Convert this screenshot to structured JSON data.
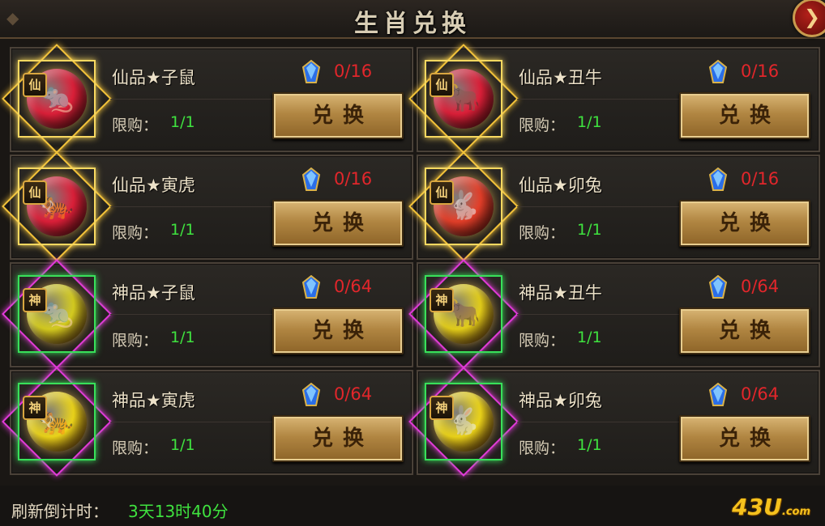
{
  "header": {
    "title": "生肖兑换",
    "close_icon": "close-arrow-icon"
  },
  "currency_icon": "blue-crystal-icon",
  "items": [
    {
      "grade_badge": "仙",
      "name": "仙品★子鼠",
      "cost": "0/16",
      "limit_label": "限购：",
      "limit_value": "1/1",
      "button_label": "兑换",
      "orb_color": "#e0203a",
      "orb_icon": "rat-icon"
    },
    {
      "grade_badge": "仙",
      "name": "仙品★丑牛",
      "cost": "0/16",
      "limit_label": "限购：",
      "limit_value": "1/1",
      "button_label": "兑换",
      "orb_color": "#e0203a",
      "orb_icon": "ox-icon"
    },
    {
      "grade_badge": "仙",
      "name": "仙品★寅虎",
      "cost": "0/16",
      "limit_label": "限购：",
      "limit_value": "1/1",
      "button_label": "兑换",
      "orb_color": "#e0203a",
      "orb_icon": "tiger-icon"
    },
    {
      "grade_badge": "仙",
      "name": "仙品★卯兔",
      "cost": "0/16",
      "limit_label": "限购：",
      "limit_value": "1/1",
      "button_label": "兑换",
      "orb_color": "#e8402a",
      "orb_icon": "rabbit-icon"
    },
    {
      "grade_badge": "神",
      "name": "神品★子鼠",
      "cost": "0/64",
      "limit_label": "限购：",
      "limit_value": "1/1",
      "button_label": "兑换",
      "orb_color": "#d9d020",
      "orb_icon": "rat-icon"
    },
    {
      "grade_badge": "神",
      "name": "神品★丑牛",
      "cost": "0/64",
      "limit_label": "限购：",
      "limit_value": "1/1",
      "button_label": "兑换",
      "orb_color": "#e8d21a",
      "orb_icon": "ox-icon"
    },
    {
      "grade_badge": "神",
      "name": "神品★寅虎",
      "cost": "0/64",
      "limit_label": "限购：",
      "limit_value": "1/1",
      "button_label": "兑换",
      "orb_color": "#f0d81a",
      "orb_icon": "tiger-icon"
    },
    {
      "grade_badge": "神",
      "name": "神品★卯兔",
      "cost": "0/64",
      "limit_label": "限购：",
      "limit_value": "1/1",
      "button_label": "兑换",
      "orb_color": "#f0d81a",
      "orb_icon": "rabbit-icon"
    }
  ],
  "footer": {
    "countdown_label": "刷新倒计时：",
    "countdown_value": "3天13时40分"
  },
  "watermark": {
    "text": "43U",
    "suffix": ".com"
  }
}
